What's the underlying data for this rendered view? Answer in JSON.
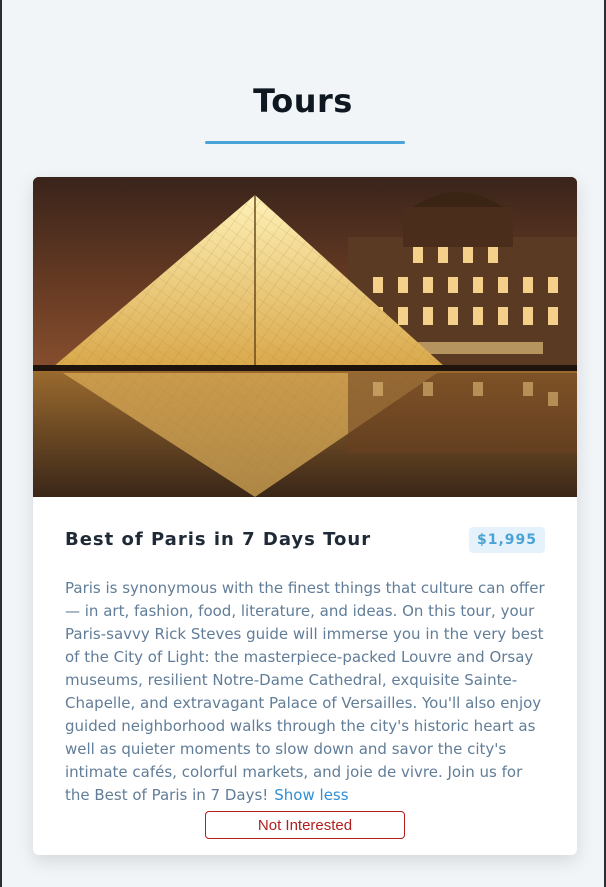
{
  "page": {
    "heading": "Tours"
  },
  "tour": {
    "name": "Best of Paris in 7 Days Tour",
    "price": "$1,995",
    "description": "Paris is synonymous with the finest things that culture can offer — in art, fashion, food, literature, and ideas. On this tour, your Paris-savvy Rick Steves guide will immerse you in the very best of the City of Light: the masterpiece-packed Louvre and Orsay museums, resilient Notre-Dame Cathedral, exquisite Sainte-Chapelle, and extravagant Palace of Versailles. You'll also enjoy guided neighborhood walks through the city's historic heart as well as quieter moments to slow down and savor the city's intimate cafés, colorful markets, and joie de vivre. Join us for the Best of Paris in 7 Days!",
    "toggle_label": "Show less",
    "dismiss_label": "Not Interested",
    "image_subject": "louvre-pyramid-night"
  },
  "colors": {
    "accent": "#4aa3d6",
    "link": "#2f8fd5",
    "danger": "#b02020",
    "heading": "#0f1720",
    "text": "#617d98",
    "background": "#f1f5f8"
  }
}
